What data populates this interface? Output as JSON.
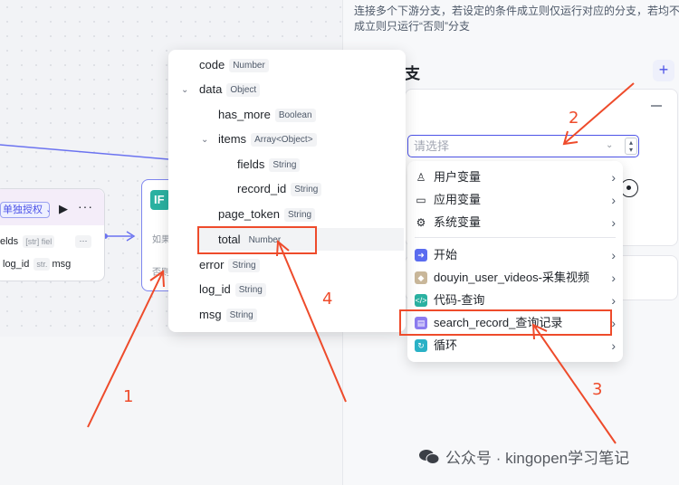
{
  "panel": {
    "description": "连接多个下游分支，若设定的条件成立则仅运行对应的分支，若均不成立则只运行“否则”分支",
    "title_fragment": "支",
    "add_label": "+",
    "select_placeholder": "请选择"
  },
  "menu": {
    "items": [
      {
        "label": "用户变量",
        "icon": "user-icon"
      },
      {
        "label": "应用变量",
        "icon": "folder-icon"
      },
      {
        "label": "系统变量",
        "icon": "gear-icon"
      },
      {
        "label": "开始",
        "icon": "start-icon",
        "color": "#5a6cf0"
      },
      {
        "label": "douyin_user_videos-采集视频",
        "icon": "plugin-avatar-icon",
        "color": "#c9b79a"
      },
      {
        "label": "代码-查询",
        "icon": "code-icon",
        "color": "#2ab1a1"
      },
      {
        "label": "search_record_查询记录",
        "icon": "database-icon",
        "color": "#8c7cf0"
      },
      {
        "label": "循环",
        "icon": "loop-icon",
        "color": "#2ab1c6"
      }
    ]
  },
  "tree": {
    "rows": [
      {
        "name": "code",
        "type": "Number"
      },
      {
        "name": "data",
        "type": "Object"
      },
      {
        "name": "has_more",
        "type": "Boolean"
      },
      {
        "name": "items",
        "type": "Array<Object>"
      },
      {
        "name": "fields",
        "type": "String"
      },
      {
        "name": "record_id",
        "type": "String"
      },
      {
        "name": "page_token",
        "type": "String"
      },
      {
        "name": "total",
        "type": "Number"
      },
      {
        "name": "error",
        "type": "String"
      },
      {
        "name": "log_id",
        "type": "String"
      },
      {
        "name": "msg",
        "type": "String"
      }
    ]
  },
  "node_left": {
    "auth_label": "单独授权",
    "fields_label": "elds",
    "fields_tag": "[str] fiel",
    "more_label": "···",
    "log_id_label": "log_id",
    "str_tag": "str.",
    "msg_label": "msg"
  },
  "if_node": {
    "badge": "IF",
    "text1": "如果",
    "text2": "否则"
  },
  "annotations": {
    "n1": "1",
    "n2": "2",
    "n3": "3",
    "n4": "4",
    "color": "#ee4b2b"
  },
  "watermark": {
    "text": "公众号 · kingopen学习笔记"
  },
  "colors": {
    "accent": "#4d53e8",
    "annotation_red": "#ee4b2b"
  }
}
